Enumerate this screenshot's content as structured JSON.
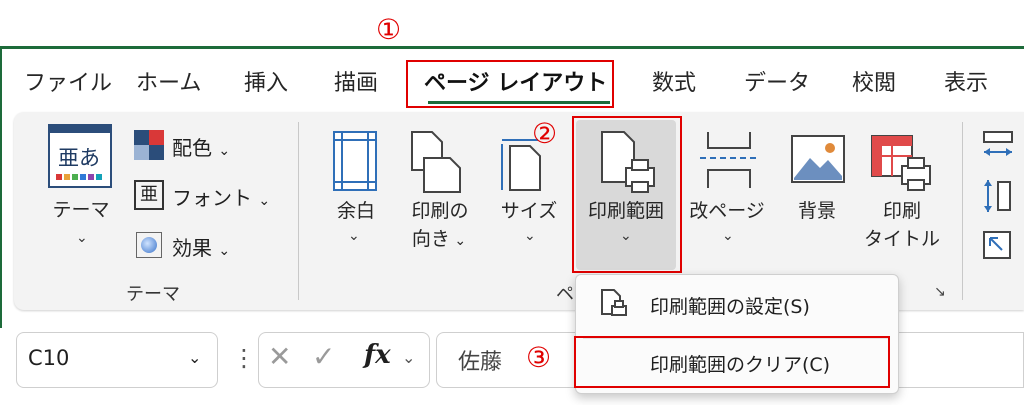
{
  "annotations": {
    "step1": "①",
    "step2": "②",
    "step3": "③"
  },
  "tabs": [
    "ファイル",
    "ホーム",
    "挿入",
    "描画",
    "ページ レイアウト",
    "数式",
    "データ",
    "校閲",
    "表示"
  ],
  "active_tab": "ページ レイアウト",
  "ribbon": {
    "theme_button": {
      "label": "テーマ",
      "icon_text": "亜あ"
    },
    "theme_options": {
      "colors": "配色",
      "fonts": "フォント",
      "effects": "効果",
      "fonts_icon_text": "亜"
    },
    "group_label_themes": "テーマ",
    "margins_label": "余白",
    "orientation_label_1": "印刷の",
    "orientation_label_2": "向き",
    "size_label": "サイズ",
    "print_area_label": "印刷範囲",
    "breaks_label": "改ページ",
    "background_label": "背景",
    "print_titles_label_1": "印刷",
    "print_titles_label_2": "タイトル",
    "group_label_pagesetup_partial": "ペ"
  },
  "dropdown_menu": {
    "items": [
      {
        "label": "印刷範囲の設定(S)",
        "accel_char": "S"
      },
      {
        "label": "印刷範囲のクリア(C)",
        "accel_char": "C"
      }
    ]
  },
  "formula_bar": {
    "name_box_value": "C10",
    "fx_label": "fx",
    "content": "佐藤"
  },
  "colors": {
    "accent_red": "#e00000",
    "excel_green": "#1d6b3a"
  }
}
